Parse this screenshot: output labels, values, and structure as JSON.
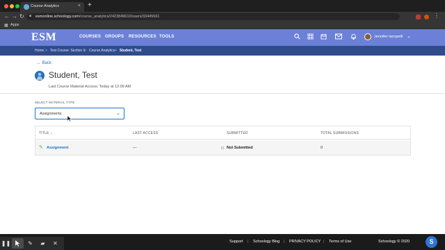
{
  "browser": {
    "tab_title": "Course Analytics",
    "tab_close": "×",
    "new_tab": "+",
    "url_domain": "esmonline.schoology.com",
    "url_path": "/course_analytics/2423849610/users/33445661",
    "bookmarks_label": "Apps",
    "nav_back": "←",
    "nav_forward": "→",
    "nav_reload": "↻"
  },
  "header": {
    "logo": "ESM",
    "nav": [
      "COURSES",
      "GROUPS",
      "RESOURCES",
      "TOOLS"
    ],
    "username": "Jennifer Iacopelli",
    "brand_color": "#6b80d6"
  },
  "breadcrumb": {
    "items": [
      "Home",
      "Test Course: Section 1",
      "Course Analytics",
      "Student, Test"
    ],
    "separator": ">"
  },
  "page": {
    "back_label": "Back",
    "student_name": "Student, Test",
    "last_access": "Last Course Material Access: Today at 12:09 AM"
  },
  "filter": {
    "label": "SELECT MATERIAL TYPE",
    "selected": "Assignments"
  },
  "table": {
    "headers": [
      "TITLE ↓",
      "LAST ACCESS",
      "SUBMITTED",
      "TOTAL SUBMISSIONS"
    ],
    "rows": [
      {
        "title": "Assignment",
        "last_access": "—",
        "submitted": "Not Submitted",
        "total": "0"
      }
    ]
  },
  "footer": {
    "links": [
      "Support",
      "Schoology Blog",
      "PRIVACY POLICY",
      "Terms of Use"
    ],
    "separator": "|",
    "copyright": "Schoology © 2020",
    "help_label": "S"
  }
}
